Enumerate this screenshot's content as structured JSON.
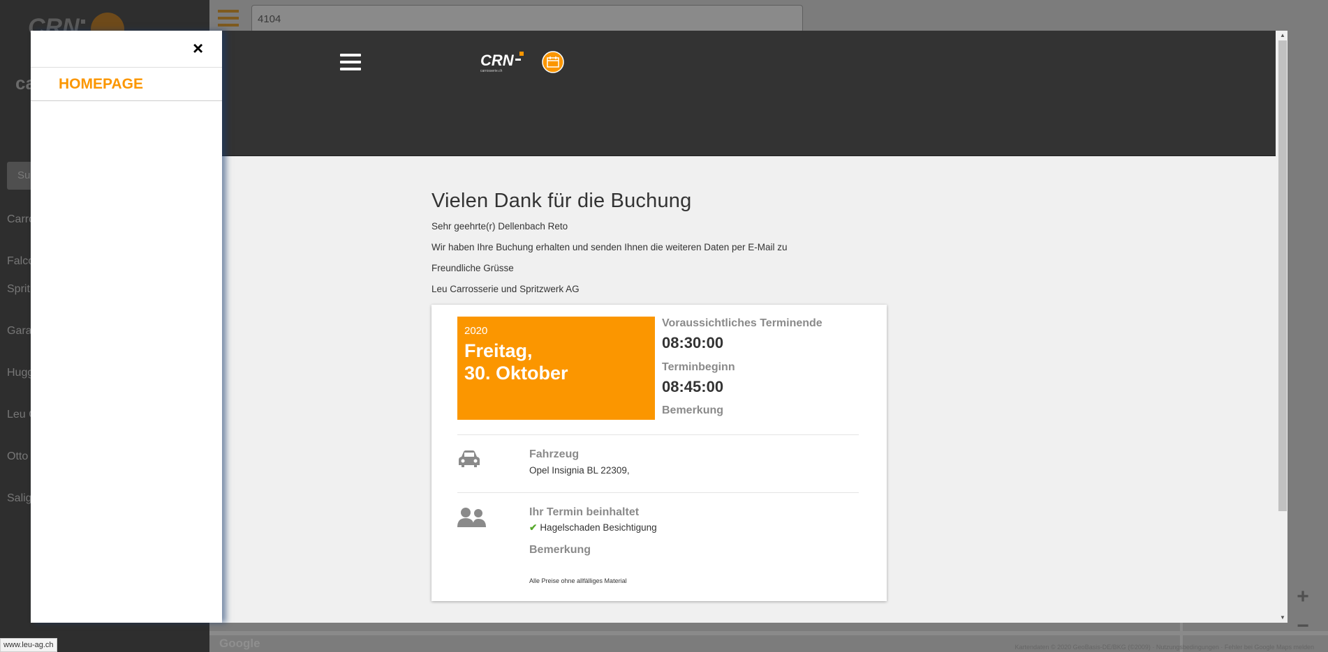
{
  "background": {
    "search_placeholder": "Su",
    "list_items": [
      "Carro",
      "Falco",
      "Sprit",
      "Gara",
      "Hugg",
      "Leu C",
      "Otto",
      "Salig"
    ],
    "left_letters": "ca",
    "map_input_value": "4104",
    "google_label": "Google",
    "attribution": "Kartendaten © 2020 GeoBasis-DE/BKG (©2009) · Nutzungsbedingungen · Fehler bei Google Maps melden",
    "zoom_in": "+",
    "zoom_out": "−"
  },
  "drawer": {
    "close_label": "×",
    "items": [
      {
        "label": "HOMEPAGE"
      }
    ]
  },
  "header": {
    "logo_text": "CRN"
  },
  "confirmation": {
    "title": "Vielen Dank für die Buchung",
    "greeting": "Sehr geehrte(r) Dellenbach Reto",
    "message": "Wir haben Ihre Buchung erhalten und senden Ihnen die weiteren Daten per E-Mail zu",
    "closing": "Freundliche Grüsse",
    "company": "Leu Carrosserie und Spritzwerk AG"
  },
  "appointment": {
    "year": "2020",
    "weekday": "Freitag,",
    "date": "30. Oktober",
    "end_label": "Voraussichtliches Terminende",
    "end_time": "08:30:00",
    "start_label": "Terminbeginn",
    "start_time": "08:45:00",
    "remark_label": "Bemerkung",
    "vehicle_label": "Fahrzeug",
    "vehicle_value": "Opel Insignia BL 22309,",
    "includes_label": "Ihr Termin beinhaltet",
    "includes_items": [
      "Hagelschaden Besichtigung"
    ],
    "remark2_label": "Bemerkung",
    "footnote": "Alle Preise ohne allfälliges Material"
  },
  "status_bar": {
    "url": "www.leu-ag.ch"
  },
  "colors": {
    "accent": "#fb9600",
    "header_bg": "#333333",
    "check_green": "#56a82b"
  },
  "icons": [
    "close-icon",
    "hamburger-menu-icon",
    "crn-logo",
    "calendar-icon",
    "car-icon",
    "users-icon",
    "checkmark-icon"
  ]
}
